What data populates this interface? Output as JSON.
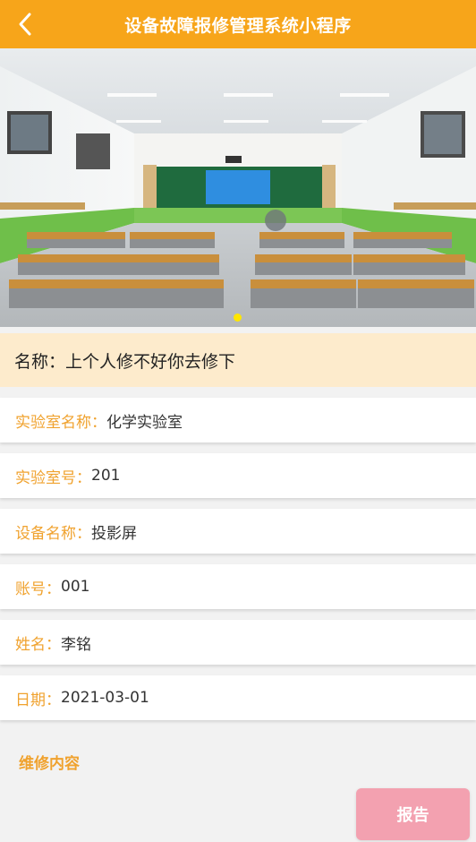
{
  "header": {
    "title": "设备故障报修管理系统小程序",
    "back_icon": "chevron-left-icon"
  },
  "banner": {
    "image": "classroom-photo",
    "slides": 1,
    "active_slide": 1,
    "indicator_color": "#ffe600"
  },
  "detail": {
    "name_label": "名称：",
    "name_value": "上个人修不好你去修下",
    "fields": [
      {
        "label": "实验室名称：",
        "value": "化学实验室"
      },
      {
        "label": "实验室号：",
        "value": "201"
      },
      {
        "label": "设备名称：",
        "value": "投影屏"
      },
      {
        "label": "账号：",
        "value": "001"
      },
      {
        "label": "姓名：",
        "value": "李铭"
      },
      {
        "label": "日期：",
        "value": "2021-03-01"
      }
    ],
    "section_title": "维修内容"
  },
  "actions": {
    "report_label": "报告"
  },
  "colors": {
    "primary": "#f7a51a",
    "label": "#f0a22e",
    "name_bar_bg": "#fdebcc",
    "report_button": "#f3a1b0"
  }
}
